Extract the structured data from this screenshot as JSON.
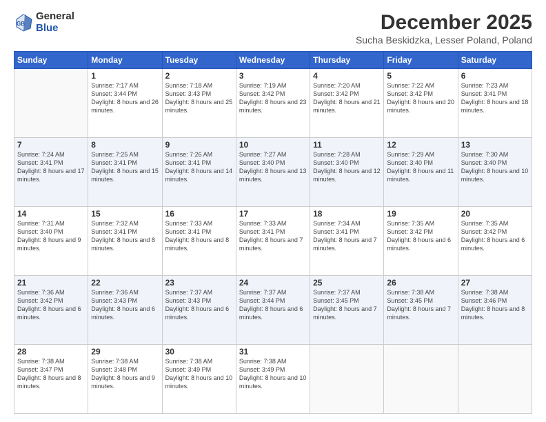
{
  "logo": {
    "general": "General",
    "blue": "Blue"
  },
  "header": {
    "month": "December 2025",
    "location": "Sucha Beskidzka, Lesser Poland, Poland"
  },
  "weekdays": [
    "Sunday",
    "Monday",
    "Tuesday",
    "Wednesday",
    "Thursday",
    "Friday",
    "Saturday"
  ],
  "weeks": [
    [
      {
        "day": "",
        "sunrise": "",
        "sunset": "",
        "daylight": ""
      },
      {
        "day": "1",
        "sunrise": "Sunrise: 7:17 AM",
        "sunset": "Sunset: 3:44 PM",
        "daylight": "Daylight: 8 hours and 26 minutes."
      },
      {
        "day": "2",
        "sunrise": "Sunrise: 7:18 AM",
        "sunset": "Sunset: 3:43 PM",
        "daylight": "Daylight: 8 hours and 25 minutes."
      },
      {
        "day": "3",
        "sunrise": "Sunrise: 7:19 AM",
        "sunset": "Sunset: 3:42 PM",
        "daylight": "Daylight: 8 hours and 23 minutes."
      },
      {
        "day": "4",
        "sunrise": "Sunrise: 7:20 AM",
        "sunset": "Sunset: 3:42 PM",
        "daylight": "Daylight: 8 hours and 21 minutes."
      },
      {
        "day": "5",
        "sunrise": "Sunrise: 7:22 AM",
        "sunset": "Sunset: 3:42 PM",
        "daylight": "Daylight: 8 hours and 20 minutes."
      },
      {
        "day": "6",
        "sunrise": "Sunrise: 7:23 AM",
        "sunset": "Sunset: 3:41 PM",
        "daylight": "Daylight: 8 hours and 18 minutes."
      }
    ],
    [
      {
        "day": "7",
        "sunrise": "Sunrise: 7:24 AM",
        "sunset": "Sunset: 3:41 PM",
        "daylight": "Daylight: 8 hours and 17 minutes."
      },
      {
        "day": "8",
        "sunrise": "Sunrise: 7:25 AM",
        "sunset": "Sunset: 3:41 PM",
        "daylight": "Daylight: 8 hours and 15 minutes."
      },
      {
        "day": "9",
        "sunrise": "Sunrise: 7:26 AM",
        "sunset": "Sunset: 3:41 PM",
        "daylight": "Daylight: 8 hours and 14 minutes."
      },
      {
        "day": "10",
        "sunrise": "Sunrise: 7:27 AM",
        "sunset": "Sunset: 3:40 PM",
        "daylight": "Daylight: 8 hours and 13 minutes."
      },
      {
        "day": "11",
        "sunrise": "Sunrise: 7:28 AM",
        "sunset": "Sunset: 3:40 PM",
        "daylight": "Daylight: 8 hours and 12 minutes."
      },
      {
        "day": "12",
        "sunrise": "Sunrise: 7:29 AM",
        "sunset": "Sunset: 3:40 PM",
        "daylight": "Daylight: 8 hours and 11 minutes."
      },
      {
        "day": "13",
        "sunrise": "Sunrise: 7:30 AM",
        "sunset": "Sunset: 3:40 PM",
        "daylight": "Daylight: 8 hours and 10 minutes."
      }
    ],
    [
      {
        "day": "14",
        "sunrise": "Sunrise: 7:31 AM",
        "sunset": "Sunset: 3:40 PM",
        "daylight": "Daylight: 8 hours and 9 minutes."
      },
      {
        "day": "15",
        "sunrise": "Sunrise: 7:32 AM",
        "sunset": "Sunset: 3:41 PM",
        "daylight": "Daylight: 8 hours and 8 minutes."
      },
      {
        "day": "16",
        "sunrise": "Sunrise: 7:33 AM",
        "sunset": "Sunset: 3:41 PM",
        "daylight": "Daylight: 8 hours and 8 minutes."
      },
      {
        "day": "17",
        "sunrise": "Sunrise: 7:33 AM",
        "sunset": "Sunset: 3:41 PM",
        "daylight": "Daylight: 8 hours and 7 minutes."
      },
      {
        "day": "18",
        "sunrise": "Sunrise: 7:34 AM",
        "sunset": "Sunset: 3:41 PM",
        "daylight": "Daylight: 8 hours and 7 minutes."
      },
      {
        "day": "19",
        "sunrise": "Sunrise: 7:35 AM",
        "sunset": "Sunset: 3:42 PM",
        "daylight": "Daylight: 8 hours and 6 minutes."
      },
      {
        "day": "20",
        "sunrise": "Sunrise: 7:35 AM",
        "sunset": "Sunset: 3:42 PM",
        "daylight": "Daylight: 8 hours and 6 minutes."
      }
    ],
    [
      {
        "day": "21",
        "sunrise": "Sunrise: 7:36 AM",
        "sunset": "Sunset: 3:42 PM",
        "daylight": "Daylight: 8 hours and 6 minutes."
      },
      {
        "day": "22",
        "sunrise": "Sunrise: 7:36 AM",
        "sunset": "Sunset: 3:43 PM",
        "daylight": "Daylight: 8 hours and 6 minutes."
      },
      {
        "day": "23",
        "sunrise": "Sunrise: 7:37 AM",
        "sunset": "Sunset: 3:43 PM",
        "daylight": "Daylight: 8 hours and 6 minutes."
      },
      {
        "day": "24",
        "sunrise": "Sunrise: 7:37 AM",
        "sunset": "Sunset: 3:44 PM",
        "daylight": "Daylight: 8 hours and 6 minutes."
      },
      {
        "day": "25",
        "sunrise": "Sunrise: 7:37 AM",
        "sunset": "Sunset: 3:45 PM",
        "daylight": "Daylight: 8 hours and 7 minutes."
      },
      {
        "day": "26",
        "sunrise": "Sunrise: 7:38 AM",
        "sunset": "Sunset: 3:45 PM",
        "daylight": "Daylight: 8 hours and 7 minutes."
      },
      {
        "day": "27",
        "sunrise": "Sunrise: 7:38 AM",
        "sunset": "Sunset: 3:46 PM",
        "daylight": "Daylight: 8 hours and 8 minutes."
      }
    ],
    [
      {
        "day": "28",
        "sunrise": "Sunrise: 7:38 AM",
        "sunset": "Sunset: 3:47 PM",
        "daylight": "Daylight: 8 hours and 8 minutes."
      },
      {
        "day": "29",
        "sunrise": "Sunrise: 7:38 AM",
        "sunset": "Sunset: 3:48 PM",
        "daylight": "Daylight: 8 hours and 9 minutes."
      },
      {
        "day": "30",
        "sunrise": "Sunrise: 7:38 AM",
        "sunset": "Sunset: 3:49 PM",
        "daylight": "Daylight: 8 hours and 10 minutes."
      },
      {
        "day": "31",
        "sunrise": "Sunrise: 7:38 AM",
        "sunset": "Sunset: 3:49 PM",
        "daylight": "Daylight: 8 hours and 10 minutes."
      },
      {
        "day": "",
        "sunrise": "",
        "sunset": "",
        "daylight": ""
      },
      {
        "day": "",
        "sunrise": "",
        "sunset": "",
        "daylight": ""
      },
      {
        "day": "",
        "sunrise": "",
        "sunset": "",
        "daylight": ""
      }
    ]
  ]
}
